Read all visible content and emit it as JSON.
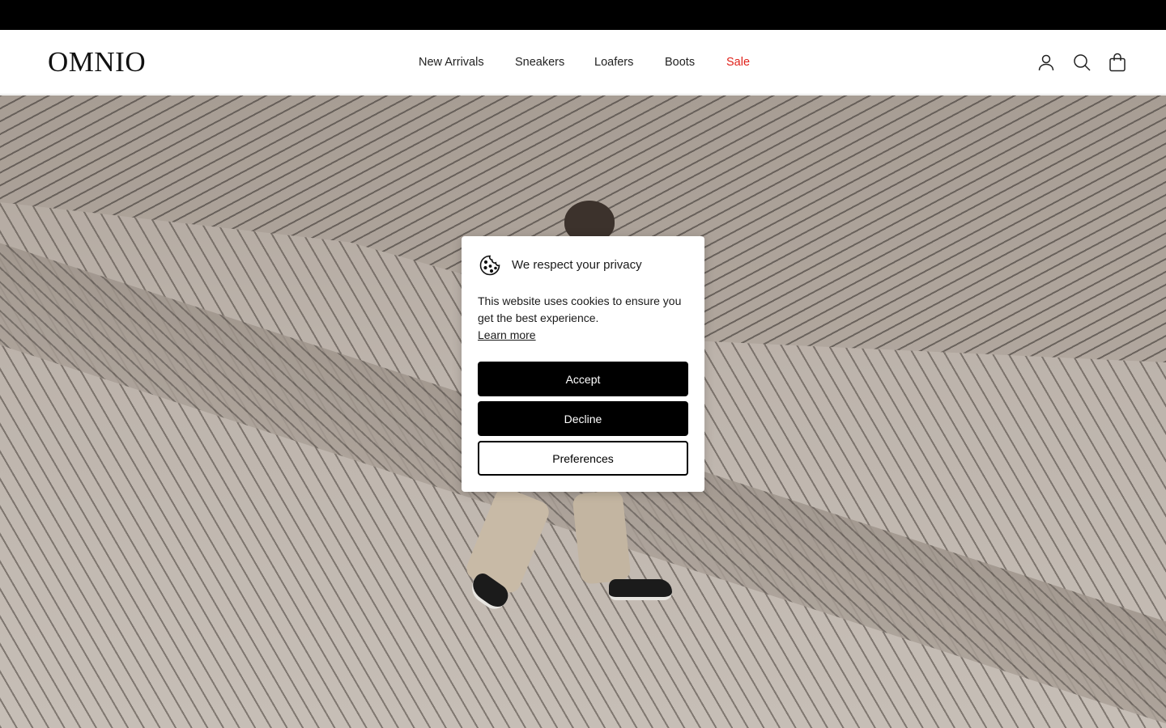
{
  "header": {
    "logo": "OMNIO",
    "nav": [
      {
        "label": "New Arrivals"
      },
      {
        "label": "Sneakers"
      },
      {
        "label": "Loafers"
      },
      {
        "label": "Boots"
      },
      {
        "label": "Sale",
        "color": "#e0221b"
      }
    ],
    "icons": [
      "account-icon",
      "search-icon",
      "bag-icon"
    ]
  },
  "cookie_banner": {
    "icon": "cookie-icon",
    "title": "We respect your privacy",
    "body": "This website uses cookies to ensure you get the best experience.",
    "learn_more": "Learn more",
    "accept_label": "Accept",
    "decline_label": "Decline",
    "preferences_label": "Preferences"
  },
  "colors": {
    "announcement_bar": "#000000",
    "sale": "#e0221b",
    "primary_button": "#000000"
  }
}
